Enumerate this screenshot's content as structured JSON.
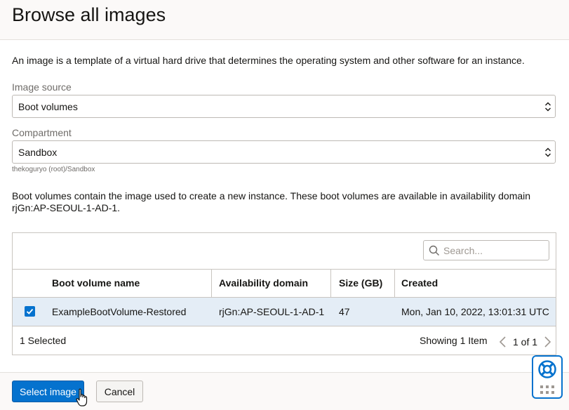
{
  "page": {
    "title": "Browse all images",
    "intro": "An image is a template of a virtual hard drive that determines the operating system and other software for an instance."
  },
  "image_source": {
    "label": "Image source",
    "value": "Boot volumes"
  },
  "compartment": {
    "label": "Compartment",
    "value": "Sandbox",
    "hint": "thekoguryo (root)/Sandbox"
  },
  "description": "Boot volumes contain the image used to create a new instance. These boot volumes are available in availability domain rjGn:AP-SEOUL-1-AD-1.",
  "table": {
    "search_placeholder": "Search...",
    "columns": [
      "Boot volume name",
      "Availability domain",
      "Size (GB)",
      "Created"
    ],
    "rows": [
      {
        "selected": true,
        "name": "ExampleBootVolume-Restored",
        "availability_domain": "rjGn:AP-SEOUL-1-AD-1",
        "size_gb": "47",
        "created": "Mon, Jan 10, 2022, 13:01:31 UTC"
      }
    ],
    "selected_text": "1 Selected",
    "showing_text": "Showing 1 Item",
    "page_text": "1 of 1"
  },
  "actions": {
    "primary": "Select image",
    "secondary": "Cancel"
  },
  "icons": {
    "select": "chevron-up-down-icon",
    "search": "search-icon",
    "checkbox": "check-icon",
    "prev": "chevron-left-icon",
    "next": "chevron-right-icon",
    "help": "lifebuoy-icon",
    "grip": "drag-handle-icon",
    "cursor": "hand-pointer-icon"
  },
  "colors": {
    "accent": "#0572ce",
    "selected_row": "#e4edf6",
    "border": "#c9c5c0",
    "muted_text": "#6f6c69"
  }
}
